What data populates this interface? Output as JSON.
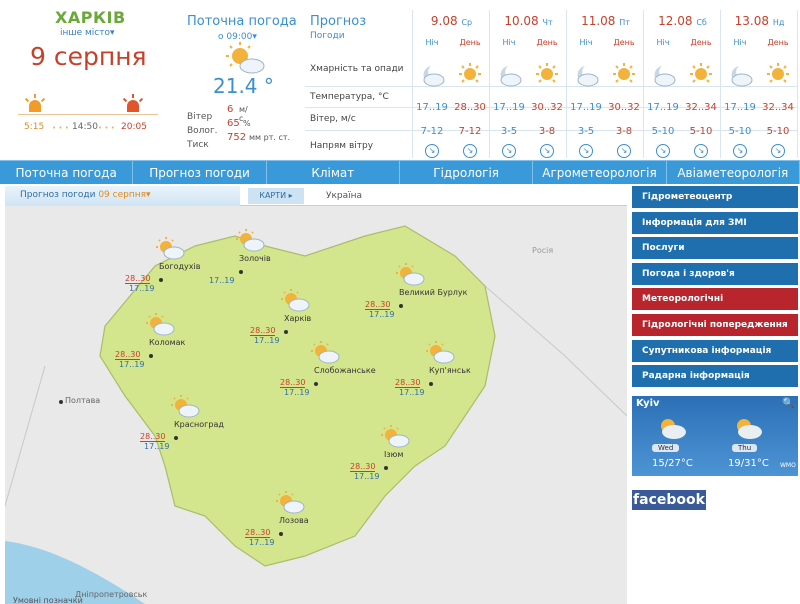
{
  "header": {
    "city": "ХАРКІВ",
    "other_city": "інше місто",
    "date_big": "9 серпня",
    "sunrise": "5:15",
    "day_length": "14:50",
    "sunset": "20:05"
  },
  "current": {
    "title": "Поточна погода",
    "time": "о 09:00",
    "temp": "21.4 °",
    "wind_label": "Вітер",
    "wind_value": "6",
    "wind_unit": "м/с",
    "humidity_label": "Волог.",
    "humidity_value": "65",
    "humidity_unit": "%",
    "pressure_label": "Тиск",
    "pressure_value": "752",
    "pressure_unit": "мм рт. ст."
  },
  "forecast": {
    "title": "Прогноз",
    "subtitle": "Погоди",
    "row_clouds": "Хмарність та опади",
    "row_temp": "Температура, °C",
    "row_wind": "Вітер, м/с",
    "row_dir": "Напрям вітру",
    "night_label": "Ніч",
    "day_label": "День",
    "days": [
      {
        "date": "9.08",
        "dow": "Ср",
        "night_temp": "17..19",
        "day_temp": "28..30",
        "night_wind": "7-12",
        "day_wind": "7-12"
      },
      {
        "date": "10.08",
        "dow": "Чт",
        "night_temp": "17..19",
        "day_temp": "30..32",
        "night_wind": "3-5",
        "day_wind": "3-8"
      },
      {
        "date": "11.08",
        "dow": "Пт",
        "night_temp": "17..19",
        "day_temp": "30..32",
        "night_wind": "3-5",
        "day_wind": "3-8"
      },
      {
        "date": "12.08",
        "dow": "Сб",
        "night_temp": "17..19",
        "day_temp": "32..34",
        "night_wind": "5-10",
        "day_wind": "5-10"
      },
      {
        "date": "13.08",
        "dow": "Нд",
        "night_temp": "17..19",
        "day_temp": "32..34",
        "night_wind": "5-10",
        "day_wind": "5-10"
      }
    ]
  },
  "nav": [
    "Поточна погода",
    "Прогноз погоди",
    "Клімат",
    "Гідрологія",
    "Агрометеорологія",
    "Авіаметеорологія"
  ],
  "tabs": {
    "forecast_label": "Прогноз погоди",
    "forecast_date": "09 серпня",
    "maps": "КАРТИ",
    "ukraine": "Україна"
  },
  "map": {
    "neighbors": {
      "russia": "Росія",
      "poltava": "Полтава",
      "dnipro": "Дніпропетровськ",
      "legend": "Умовні позначки"
    },
    "cities": [
      {
        "name": "Богодухів",
        "high": "28..30",
        "low": "17..19"
      },
      {
        "name": "Золочів",
        "high": "",
        "low": "17..19"
      },
      {
        "name": "Великий Бурлук",
        "high": "28..30",
        "low": "17..19"
      },
      {
        "name": "Харків",
        "high": "28..30",
        "low": "17..19"
      },
      {
        "name": "Коломак",
        "high": "28..30",
        "low": "17..19"
      },
      {
        "name": "Слобожанське",
        "high": "28..30",
        "low": "17..19"
      },
      {
        "name": "Куп'янськ",
        "high": "28..30",
        "low": "17..19"
      },
      {
        "name": "Красноград",
        "high": "28..30",
        "low": "17..19"
      },
      {
        "name": "Ізюм",
        "high": "28..30",
        "low": "17..19"
      },
      {
        "name": "Лозова",
        "high": "28..30",
        "low": "17..19"
      }
    ]
  },
  "sidebar": [
    {
      "label": "Гідрометеоцентр",
      "color": "#1f6fae"
    },
    {
      "label": "Інформація для ЗМІ",
      "color": "#1f6fae"
    },
    {
      "label": "Послуги",
      "color": "#1f6fae"
    },
    {
      "label": "Погода і здоров'я",
      "color": "#1f6fae"
    },
    {
      "label": "Метеорологічні попередження",
      "color": "#b8252d"
    },
    {
      "label": "Гідрологічні попередження",
      "color": "#b8252d"
    },
    {
      "label": "Супутникова інформація",
      "color": "#1f6fae"
    },
    {
      "label": "Радарна інформація",
      "color": "#1f6fae"
    }
  ],
  "kyiv_widget": {
    "city": "Kyiv",
    "d1": "Wed",
    "t1": "15/27°C",
    "d2": "Thu",
    "t2": "19/31°C",
    "logo": "WMO"
  },
  "facebook": "facebook"
}
